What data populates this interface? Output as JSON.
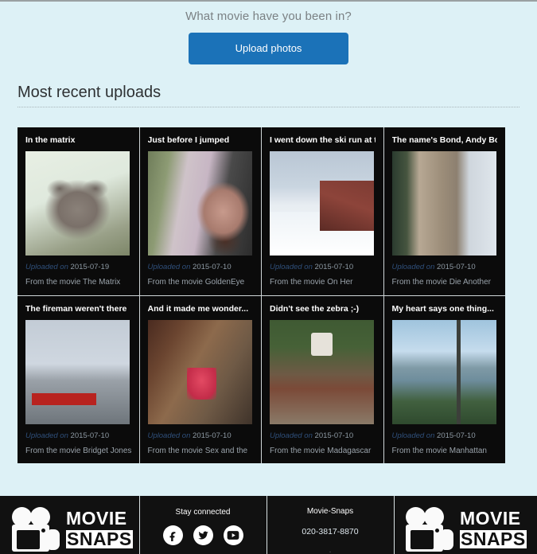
{
  "hero": {
    "question": "What movie have you been in?",
    "upload_button": "Upload photos"
  },
  "section": {
    "title": "Most recent uploads"
  },
  "cards": [
    {
      "title": "In the matrix",
      "uploaded_label": "Uploaded on",
      "uploaded_date": "2015-07-19",
      "movie": "From the movie The Matrix",
      "photo": "ph-cat"
    },
    {
      "title": "Just before I jumped",
      "uploaded_label": "Uploaded on",
      "uploaded_date": "2015-07-10",
      "movie": "From the movie GoldenEye",
      "photo": "ph-jump"
    },
    {
      "title": "I went down the ski run at the",
      "uploaded_label": "Uploaded on",
      "uploaded_date": "2015-07-10",
      "movie": "From the movie On Her",
      "photo": "ph-ski"
    },
    {
      "title": "The name's Bond, Andy Bond.",
      "uploaded_label": "Uploaded on",
      "uploaded_date": "2015-07-10",
      "movie": "From the movie Die Another",
      "photo": "ph-bond"
    },
    {
      "title": "The fireman weren't there",
      "uploaded_label": "Uploaded on",
      "uploaded_date": "2015-07-10",
      "movie": "From the movie Bridget Jones's",
      "photo": "ph-fire"
    },
    {
      "title": "And it made me wonder...",
      "uploaded_label": "Uploaded on",
      "uploaded_date": "2015-07-10",
      "movie": "From the movie Sex and the",
      "photo": "ph-sex"
    },
    {
      "title": "Didn't see the zebra ;-)",
      "uploaded_label": "Uploaded on",
      "uploaded_date": "2015-07-10",
      "movie": "From the movie Madagascar",
      "photo": "ph-zebra"
    },
    {
      "title": "My heart says one thing...",
      "uploaded_label": "Uploaded on",
      "uploaded_date": "2015-07-10",
      "movie": "From the movie Manhattan",
      "photo": "ph-manh"
    }
  ],
  "footer": {
    "brand_top": "MOVIE",
    "brand_bottom": "SNAPS",
    "stay_connected": "Stay connected",
    "social": [
      {
        "name": "facebook-icon",
        "label": "Facebook"
      },
      {
        "name": "twitter-icon",
        "label": "Twitter"
      },
      {
        "name": "youtube-icon",
        "label": "YouTube"
      }
    ],
    "contact_name": "Movie-Snaps",
    "contact_phone": "020-3817-8870"
  },
  "colors": {
    "page_background": "#ddf1f6",
    "accent_blue": "#1b72b8",
    "card_background": "#0b0b0b",
    "footer_background": "#111111"
  }
}
